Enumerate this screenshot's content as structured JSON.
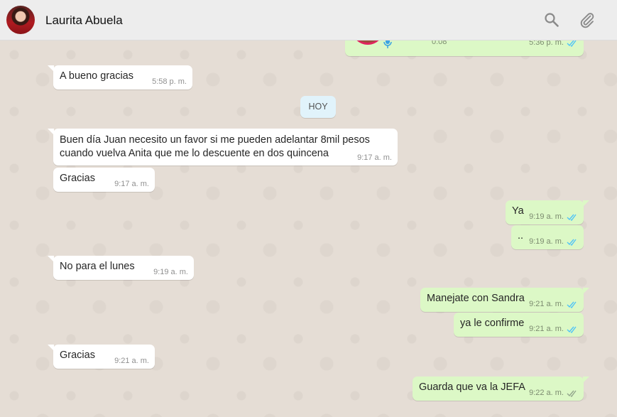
{
  "header": {
    "contact_name": "Laurita Abuela",
    "icons": [
      "search-icon",
      "attach-icon"
    ]
  },
  "chat": {
    "audio_message": {
      "duration": "0:08",
      "time": "5:36 p. m.",
      "status": "read"
    },
    "day_divider": "HOY",
    "messages": [
      {
        "dir": "in",
        "lines": [
          "A bueno gracias"
        ],
        "time": "5:58 p. m."
      },
      {
        "dir": "in",
        "lines": [
          "Buen día Juan necesito un favor si me pueden adelantar 8mil pesos",
          "cuando vuelva Anita que me lo descuente en dos quincena"
        ],
        "time": "9:17 a. m."
      },
      {
        "dir": "in",
        "lines": [
          "Gracias"
        ],
        "time": "9:17 a. m."
      },
      {
        "dir": "out",
        "lines": [
          "Ya"
        ],
        "time": "9:19 a. m.",
        "status": "read"
      },
      {
        "dir": "out",
        "lines": [
          ".."
        ],
        "time": "9:19 a. m.",
        "status": "read"
      },
      {
        "dir": "in",
        "lines": [
          "No para el lunes"
        ],
        "time": "9:19 a. m."
      },
      {
        "dir": "out",
        "lines": [
          "Manejate con Sandra"
        ],
        "time": "9:21 a. m.",
        "status": "read"
      },
      {
        "dir": "out",
        "lines": [
          "ya le confirme"
        ],
        "time": "9:21 a. m.",
        "status": "read"
      },
      {
        "dir": "in",
        "lines": [
          "Gracias"
        ],
        "time": "9:21 a. m."
      },
      {
        "dir": "out",
        "lines": [
          "Guarda que va la JEFA"
        ],
        "time": "9:22 a. m.",
        "status": "delivered"
      }
    ]
  },
  "colors": {
    "incoming_bubble": "#ffffff",
    "outgoing_bubble": "#dcf8c6",
    "read_tick": "#4fc3f7",
    "delivered_tick": "#92a58c",
    "day_chip": "#e1f3fb"
  }
}
